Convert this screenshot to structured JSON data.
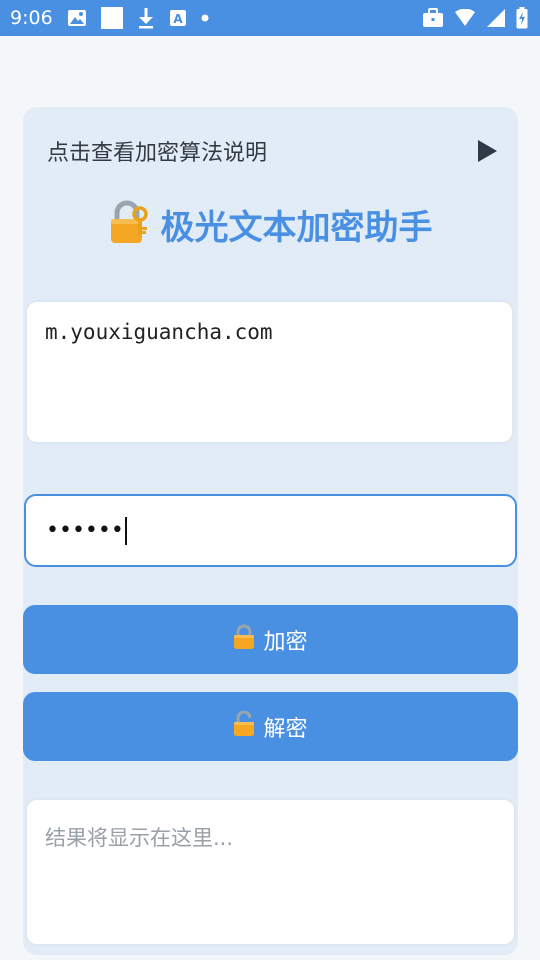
{
  "status_bar": {
    "time": "9:06",
    "left_icons": [
      "image-icon",
      "white-square-icon",
      "download-icon",
      "font-a-icon",
      "dot-icon"
    ],
    "right_icons": [
      "briefcase-icon",
      "wifi-icon",
      "signal-icon",
      "battery-charging-icon"
    ]
  },
  "colors": {
    "accent": "#4a90e2",
    "card_background": "#e2ecf7",
    "page_background": "#f4f6fa"
  },
  "explain": {
    "label": "点击查看加密算法说明",
    "icon": "play-triangle-icon"
  },
  "header": {
    "title": "极光文本加密助手",
    "icon": "lock-with-key-icon"
  },
  "input": {
    "value": "m.youxiguancha.com"
  },
  "password": {
    "masked_value": "••••••"
  },
  "buttons": {
    "encrypt": {
      "label": "加密",
      "icon": "lock-icon"
    },
    "decrypt": {
      "label": "解密",
      "icon": "unlock-icon"
    }
  },
  "result": {
    "placeholder": "结果将显示在这里..."
  }
}
